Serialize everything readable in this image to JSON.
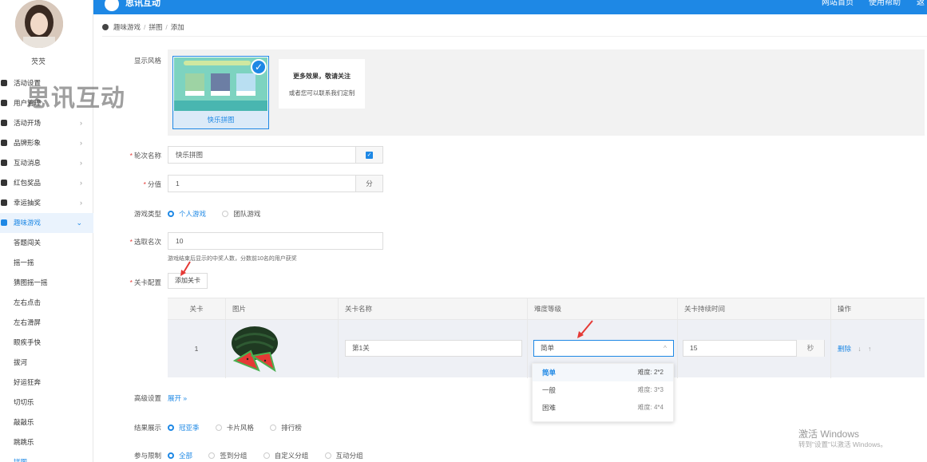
{
  "colors": {
    "primary": "#1e88e5",
    "required": "#e53935",
    "watermark": "#505050"
  },
  "header": {
    "brand": "思讯互动",
    "links": [
      "网站首页",
      "使用帮助",
      "返"
    ]
  },
  "user": {
    "name": "芡芡"
  },
  "watermark": "思讯互动",
  "sidebar": {
    "items": [
      {
        "label": "活动设置",
        "icon": "gear-icon"
      },
      {
        "label": "用户管理",
        "icon": "user-icon"
      },
      {
        "label": "活动开场",
        "icon": "send-icon"
      },
      {
        "label": "品牌形象",
        "icon": "registered-icon"
      },
      {
        "label": "互动消息",
        "icon": "chat-icon"
      },
      {
        "label": "红包奖品",
        "icon": "gift-icon"
      },
      {
        "label": "幸运抽奖",
        "icon": "grid-icon"
      },
      {
        "label": "趣味游戏",
        "icon": "game-icon"
      }
    ],
    "sub_items": [
      "答题闯关",
      "摇一摇",
      "猜图摇一摇",
      "左右点击",
      "左右滑屏",
      "眼疾手快",
      "拔河",
      "好运狂奔",
      "切切乐",
      "敲敲乐",
      "跳跳乐",
      "拼图"
    ]
  },
  "breadcrumb": [
    "趣味游戏",
    "拼图",
    "添加"
  ],
  "form": {
    "style_label": "显示风格",
    "style_card_label": "快乐拼图",
    "more_title": "更多效果，敬请关注",
    "more_sub": "或者您可以联系我们定制",
    "round_label": "轮次名称",
    "round_value": "快乐拼图",
    "score_label": "分值",
    "score_value": "1",
    "score_unit": "分",
    "game_type_label": "游戏类型",
    "game_type_options": [
      "个人游戏",
      "团队游戏"
    ],
    "pick_label": "选取名次",
    "pick_value": "10",
    "pick_hint": "游戏结束后显示的中奖人数，分数前10名的用户获奖",
    "level_label": "关卡配置",
    "add_level": "添加关卡",
    "advanced_label": "高级设置",
    "expand": "展开 »",
    "result_label": "结果展示",
    "result_options": [
      "冠亚季",
      "卡片风格",
      "排行榜"
    ],
    "limit_label": "参与限制",
    "limit_options": [
      "全部",
      "签到分组",
      "自定义分组",
      "互动分组"
    ]
  },
  "table": {
    "headers": [
      "关卡",
      "图片",
      "关卡名称",
      "难度等级",
      "关卡持续时间",
      "操作"
    ],
    "row": {
      "index": "1",
      "name": "第1关",
      "difficulty": "简单",
      "duration": "15",
      "duration_unit": "秒",
      "delete": "删除",
      "down": "↓",
      "up": "↑"
    }
  },
  "dropdown": [
    {
      "label": "简单",
      "diff": "难度: 2*2"
    },
    {
      "label": "一般",
      "diff": "难度: 3*3"
    },
    {
      "label": "困难",
      "diff": "难度: 4*4"
    }
  ],
  "windows": {
    "title": "激活 Windows",
    "sub": "转到\"设置\"以激活 Windows。"
  }
}
